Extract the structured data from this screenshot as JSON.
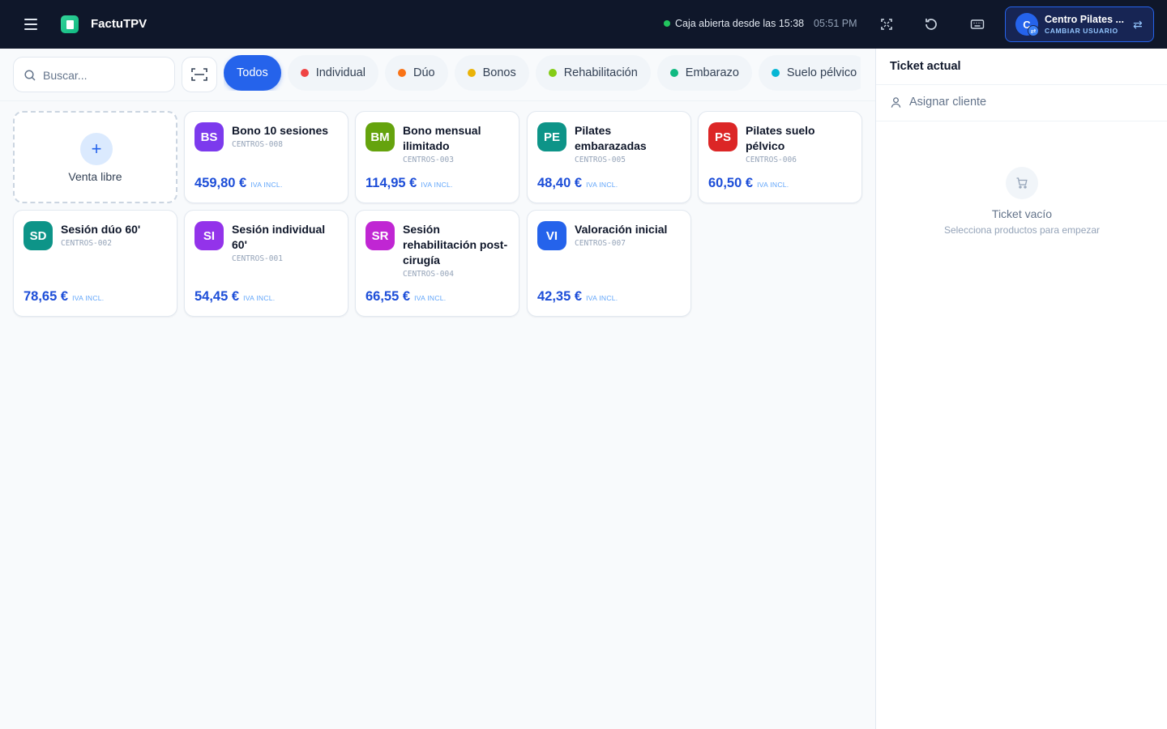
{
  "header": {
    "app_title": "FactuTPV",
    "status": "Caja abierta desde las 15:38",
    "time": "05:51 PM",
    "user": {
      "initial": "C",
      "name": "Centro Pilates ...",
      "switch_label": "CAMBIAR USUARIO"
    },
    "icons": [
      "menu-icon",
      "logo-icon",
      "fullscreen-icon",
      "refresh-icon",
      "keyboard-icon",
      "swap-icon"
    ]
  },
  "search": {
    "placeholder": "Buscar..."
  },
  "categories": [
    {
      "label": "Todos",
      "active": true
    },
    {
      "label": "Individual",
      "color": "#ef4444"
    },
    {
      "label": "Dúo",
      "color": "#f97316"
    },
    {
      "label": "Bonos",
      "color": "#eab308"
    },
    {
      "label": "Rehabilitación",
      "color": "#84cc16"
    },
    {
      "label": "Embarazo",
      "color": "#10b981"
    },
    {
      "label": "Suelo pélvico",
      "color": "#06b6d4"
    }
  ],
  "free_sale": {
    "label": "Venta libre"
  },
  "tax_label": "IVA INCL.",
  "products": [
    {
      "initials": "BS",
      "name": "Bono 10 sesiones",
      "sku": "CENTROS-008",
      "price": "459,80 €",
      "color": "#7c3aed"
    },
    {
      "initials": "BM",
      "name": "Bono mensual ilimitado",
      "sku": "CENTROS-003",
      "price": "114,95 €",
      "color": "#65a30d"
    },
    {
      "initials": "PE",
      "name": "Pilates embarazadas",
      "sku": "CENTROS-005",
      "price": "48,40 €",
      "color": "#0d9488"
    },
    {
      "initials": "PS",
      "name": "Pilates suelo pélvico",
      "sku": "CENTROS-006",
      "price": "60,50 €",
      "color": "#dc2626"
    },
    {
      "initials": "SD",
      "name": "Sesión dúo 60'",
      "sku": "CENTROS-002",
      "price": "78,65 €",
      "color": "#0d9488"
    },
    {
      "initials": "SI",
      "name": "Sesión individual 60'",
      "sku": "CENTROS-001",
      "price": "54,45 €",
      "color": "#9333ea"
    },
    {
      "initials": "SR",
      "name": "Sesión rehabilitación post-cirugía",
      "sku": "CENTROS-004",
      "price": "66,55 €",
      "color": "#c026d3"
    },
    {
      "initials": "VI",
      "name": "Valoración inicial",
      "sku": "CENTROS-007",
      "price": "42,35 €",
      "color": "#2563eb"
    }
  ],
  "ticket": {
    "title": "Ticket actual",
    "assign_client": "Asignar cliente",
    "empty_title": "Ticket vacío",
    "empty_subtitle": "Selecciona productos para empezar"
  }
}
